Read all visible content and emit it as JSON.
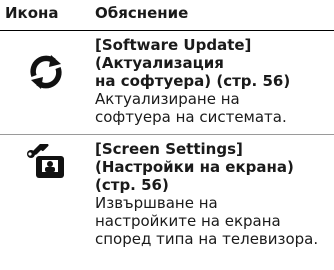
{
  "table": {
    "header": {
      "icon": "Икона",
      "explanation": "Обяснение"
    },
    "rows": [
      {
        "icon_name": "refresh-icon",
        "title_lines": [
          "[Software Update]",
          "(Актуализация",
          "на софтуера) (стр. 56)"
        ],
        "desc_lines": [
          "Актуализиране на",
          "софтуера на системата."
        ]
      },
      {
        "icon_name": "screen-settings-icon",
        "title_lines": [
          "[Screen Settings]",
          "(Настройки на екрана)",
          "(стр. 56)"
        ],
        "desc_lines": [
          "Извършване на",
          "настройките на екрана",
          "според типа на телевизора."
        ]
      }
    ]
  }
}
